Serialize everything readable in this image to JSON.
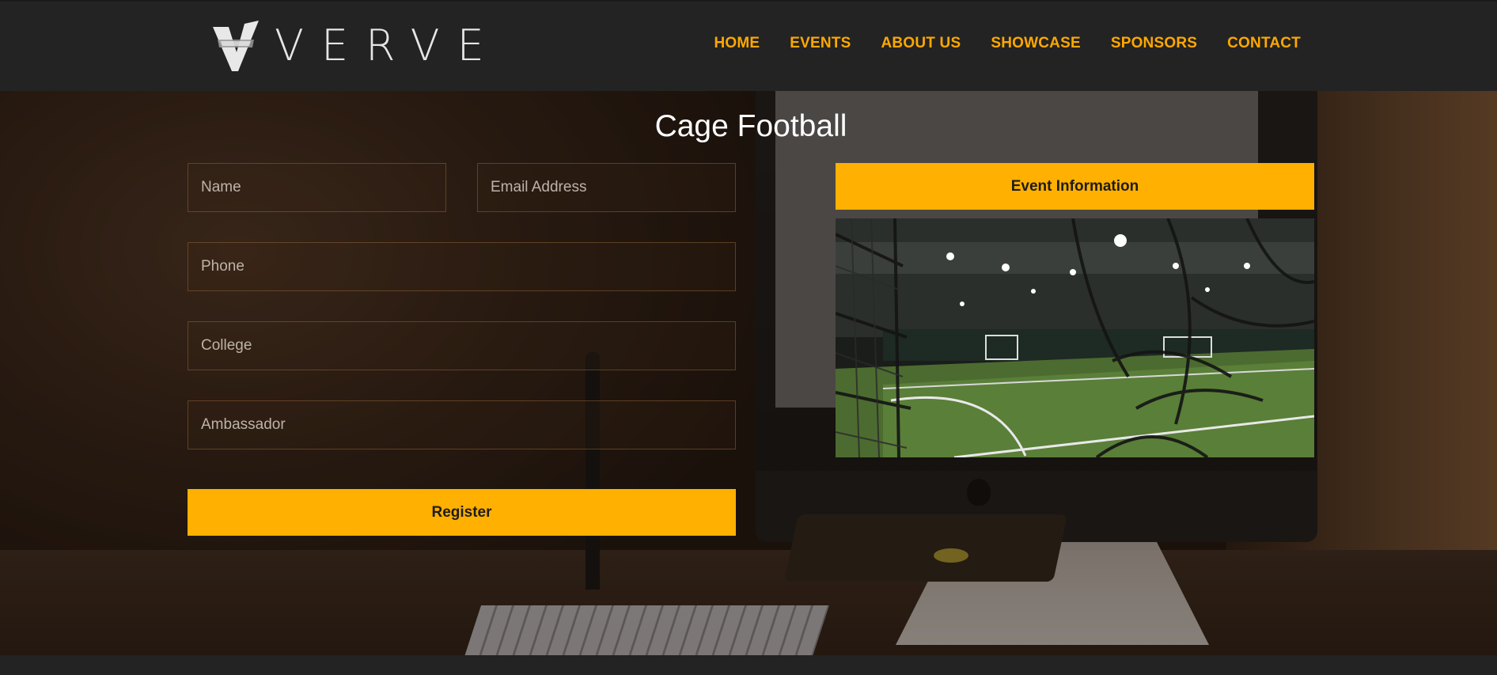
{
  "brand": {
    "name": "VERVE",
    "colors": {
      "accent": "#ffb000",
      "nav_text": "#ffa800",
      "header_bg": "#232323"
    }
  },
  "nav": {
    "items": [
      {
        "label": "HOME",
        "name": "nav-home"
      },
      {
        "label": "EVENTS",
        "name": "nav-events"
      },
      {
        "label": "ABOUT US",
        "name": "nav-about-us"
      },
      {
        "label": "SHOWCASE",
        "name": "nav-showcase"
      },
      {
        "label": "SPONSORS",
        "name": "nav-sponsors"
      },
      {
        "label": "CONTACT",
        "name": "nav-contact"
      }
    ]
  },
  "page": {
    "title": "Cage Football"
  },
  "form": {
    "name_placeholder": "Name",
    "email_placeholder": "Email Address",
    "phone_placeholder": "Phone",
    "college_placeholder": "College",
    "ambassador_placeholder": "Ambassador",
    "submit_label": "Register"
  },
  "event": {
    "info_button_label": "Event Information",
    "image_icon": "soccer-cage-photo"
  }
}
